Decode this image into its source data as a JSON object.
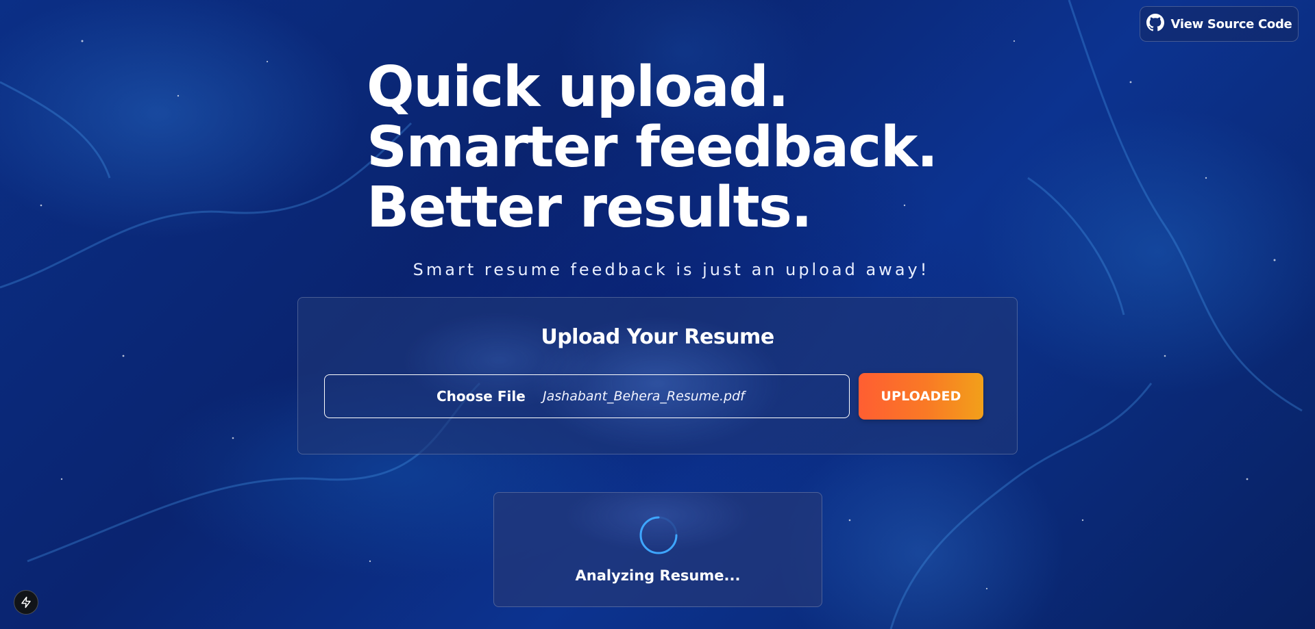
{
  "header": {
    "source_button_label": "View Source Code",
    "source_button_icon": "github-icon"
  },
  "hero": {
    "lines": [
      "Quick upload.",
      "Smarter feedback.",
      "Better results."
    ],
    "tagline": "Smart resume feedback is just an upload away!"
  },
  "upload": {
    "title": "Upload Your Resume",
    "choose_file_label": "Choose File",
    "file_name": "Jashabant_Behera_Resume.pdf",
    "submit_label": "UPLOADED"
  },
  "status": {
    "text": "Analyzing Resume...",
    "icon": "loading-spinner-icon"
  },
  "footer": {
    "dev_tools_icon": "lightning-bolt-icon"
  },
  "colors": {
    "background": "#0a2a7a",
    "accent_start": "#ff5e32",
    "accent_end": "#f2a01a",
    "spinner": "#3ea6ff"
  }
}
